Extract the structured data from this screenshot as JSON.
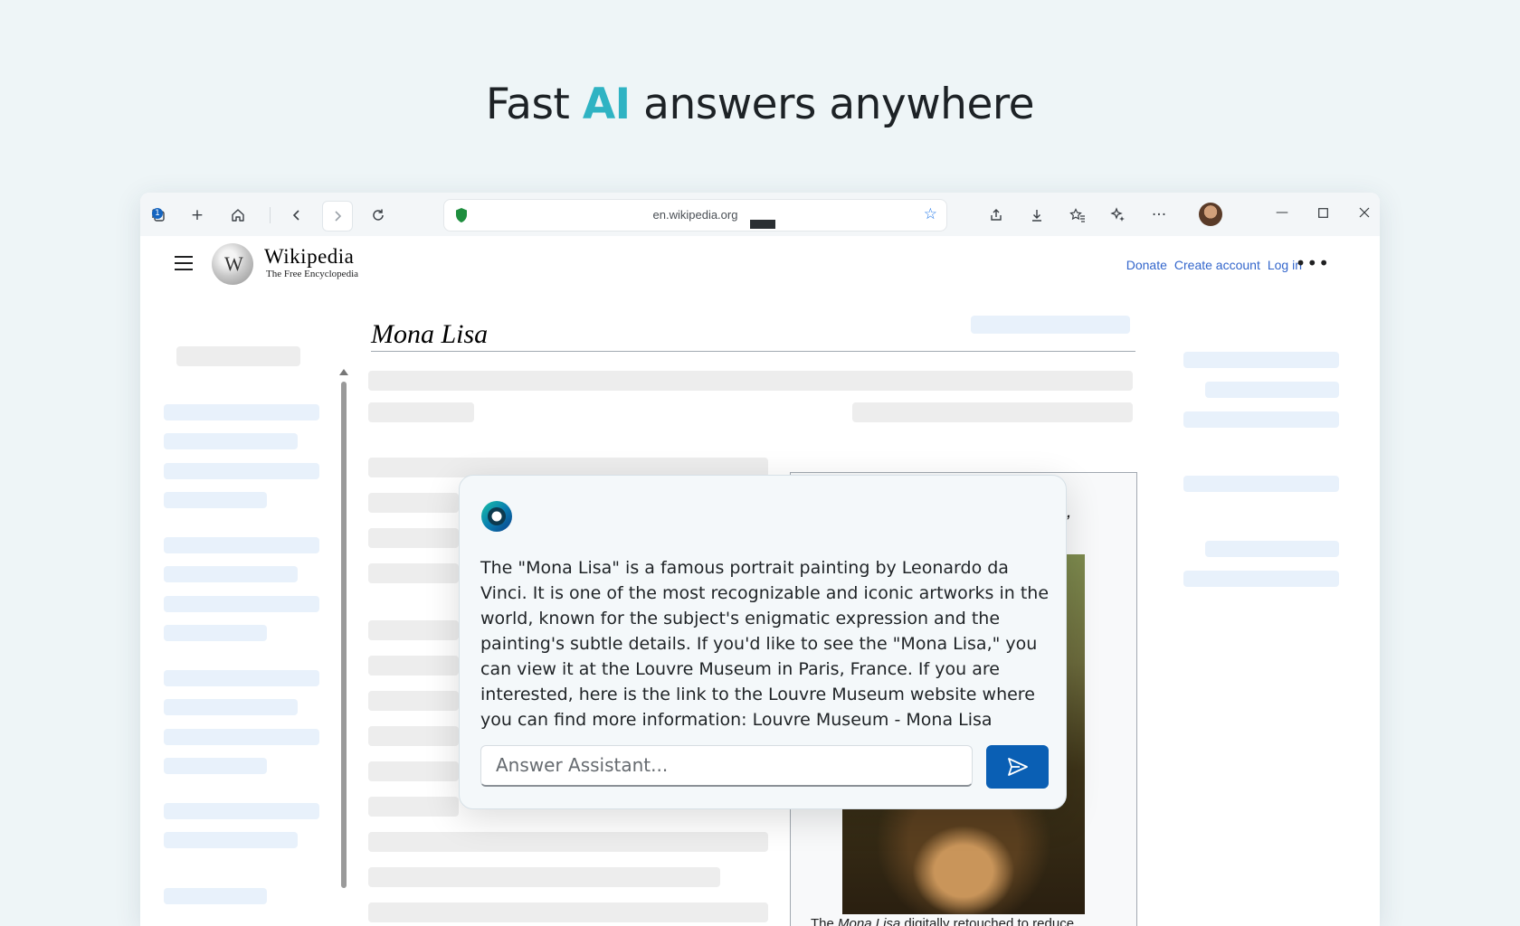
{
  "hero": {
    "prefix": "Fast",
    "accent": "AI",
    "suffix": "answers anywhere"
  },
  "browser": {
    "tab_count": "1",
    "url": "en.wikipedia.org",
    "icons": [
      "tabs-icon",
      "new-tab-icon",
      "home-icon",
      "back-icon",
      "forward-icon",
      "refresh-icon",
      "shield-icon",
      "favorite-star-icon",
      "share-icon",
      "download-icon",
      "favorites-icon",
      "copilot-icon",
      "more-icon",
      "profile-avatar",
      "minimize-icon",
      "maximize-icon",
      "close-icon"
    ]
  },
  "wiki": {
    "wordmark": "Wikipedia",
    "tagline": "The Free Encyclopedia",
    "links": {
      "donate": "Donate",
      "create_account": "Create account",
      "log_in": "Log in"
    },
    "article_title": "Mona Lisa",
    "infobox_fragment": "a,",
    "caption_the": "The",
    "caption_title": "Mona Lisa",
    "caption_rest": "digitally retouched to reduce"
  },
  "assistant": {
    "answer": "The \"Mona Lisa\" is a famous portrait painting by Leonardo da Vinci. It is one of the most recognizable and iconic artworks in the world, known for the subject's enigmatic expression and the painting's subtle details. If you'd like to see the \"Mona Lisa,\" you can view it at the Louvre Museum in Paris, France. If you are interested, here is the link to the Louvre Museum website where you can find more information: Louvre Museum - Mona Lisa",
    "input_placeholder": "Answer Assistant...",
    "accent_color": "#0a5fb4"
  },
  "colors": {
    "hero_accent": "#2fb3c3",
    "link": "#3366cc"
  }
}
